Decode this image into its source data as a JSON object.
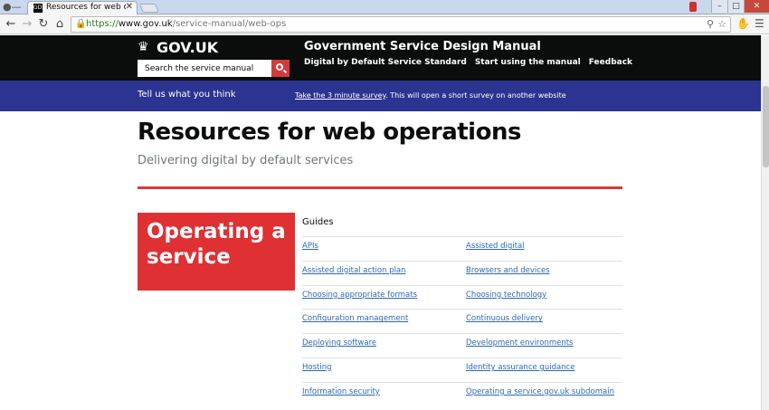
{
  "browser": {
    "tab_title": "Resources for web operations",
    "tab_favicon_text": "GDS",
    "tab_close": "✕",
    "url_scheme": "https://",
    "url_host": "www.gov.uk",
    "url_path": "/service-manual/web-ops",
    "icons": [
      "back-arrow-icon",
      "forward-arrow-icon",
      "reload-icon",
      "home-icon",
      "lock-icon",
      "search-icon",
      "star-icon",
      "extension-icon",
      "menu-icon"
    ]
  },
  "header": {
    "logo": "GOV.UK",
    "search_placeholder": "Search the service manual",
    "manual_title": "Government Service Design Manual",
    "nav": [
      {
        "label": "Digital by Default Service Standard"
      },
      {
        "label": "Start using the manual"
      },
      {
        "label": "Feedback"
      }
    ]
  },
  "banner": {
    "title": "Tell us what you think",
    "link": "Take the 3 minute survey",
    "text": ". This will open a short survey on another website"
  },
  "main": {
    "title": "Resources for web operations",
    "subtitle": "Delivering digital by default services",
    "section_title": "Operating a service",
    "guides_heading": "Guides",
    "guides": [
      [
        "APIs",
        "Assisted digital"
      ],
      [
        "Assisted digital action plan",
        "Browsers and devices"
      ],
      [
        "Choosing appropriate formats",
        "Choosing technology"
      ],
      [
        "Configuration management",
        "Continuous delivery"
      ],
      [
        "Deploying software",
        "Development environments"
      ],
      [
        "Hosting",
        "Identity assurance guidance"
      ],
      [
        "Information security",
        "Operating a service.gov.uk subdomain"
      ]
    ]
  },
  "colors": {
    "header_bg": "#0b0c0c",
    "banner_bg": "#2b3490",
    "accent_red": "#d53a3a",
    "section_red": "#df3034",
    "link": "#2b69b8"
  }
}
